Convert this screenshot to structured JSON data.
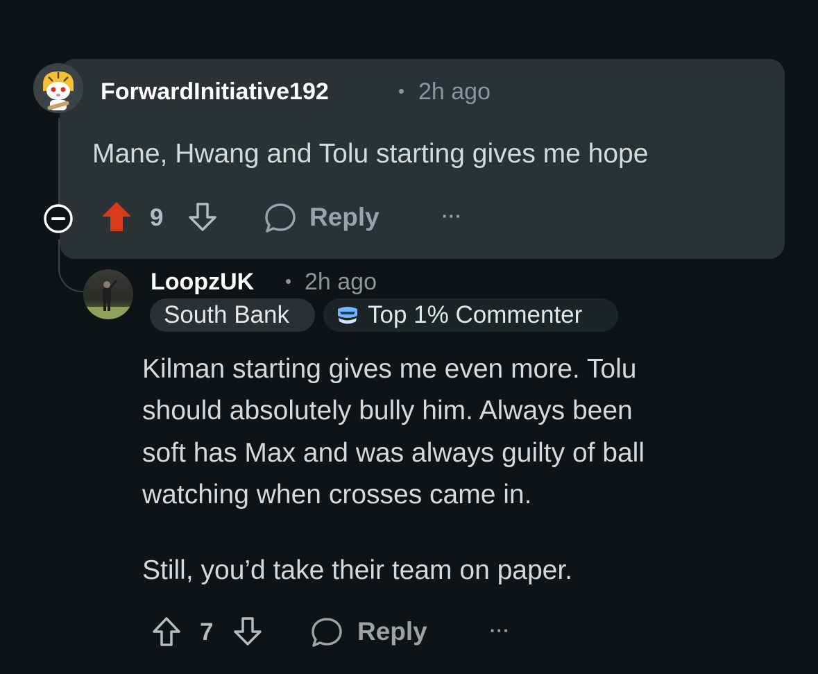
{
  "parent_comment": {
    "username": "ForwardInitiative192",
    "separator": "•",
    "time": "2h ago",
    "text": "Mane, Hwang and Tolu starting gives me hope",
    "vote_count": "9",
    "reply_label": "Reply",
    "more_label": "···",
    "upvoted": true,
    "upvote_color": "#d93a1c",
    "collapse_icon": "minus-circle-icon",
    "avatar_icon": "tiger-snoo-avatar"
  },
  "reply_comment": {
    "username": "LoopzUK",
    "separator": "•",
    "time": "2h ago",
    "flair": "South Bank",
    "badge": "Top 1% Commenter",
    "badge_icon": "commenter-award-icon",
    "paragraphs": [
      "Kilman starting gives me even more. Tolu should absolutely bully him. Always been soft has Max and was always guilty of ball watching when crosses came in.",
      "Still, you’d take their team on paper."
    ],
    "lines": [
      "Kilman starting gives me even more. Tolu",
      "should absolutely bully him. Always been",
      "soft has Max and was always guilty of ball",
      "watching when crosses came in."
    ],
    "vote_count": "7",
    "reply_label": "Reply",
    "more_label": "···",
    "avatar_icon": "photo-avatar"
  },
  "colors": {
    "background": "#0e1315",
    "highlight": "#2b3236",
    "text": "#d3d9dd",
    "muted": "#8b959b"
  }
}
